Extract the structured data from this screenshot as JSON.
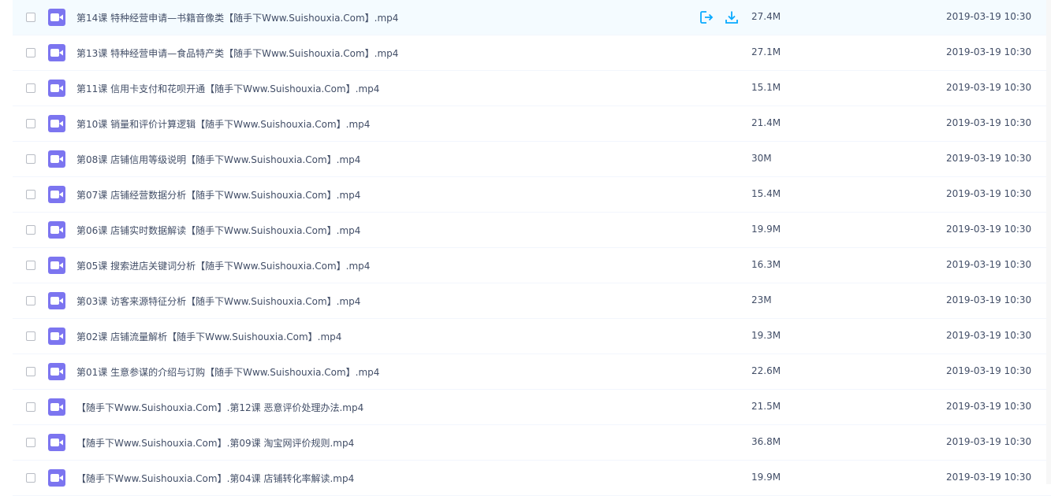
{
  "colors": {
    "accent": "#09aaff",
    "video_icon": "#7c75f0",
    "hover_row": "#f4fbff"
  },
  "row_actions": {
    "share_icon": "share-icon",
    "download_icon": "download-icon"
  },
  "files": [
    {
      "name": "第14课 特种经营申请—书籍音像类【随手下Www.Suishouxia.Com】.mp4",
      "size": "27.4M",
      "date": "2019-03-19 10:30",
      "hovered": true
    },
    {
      "name": "第13课 特种经营申请—食品特产类【随手下Www.Suishouxia.Com】.mp4",
      "size": "27.1M",
      "date": "2019-03-19 10:30"
    },
    {
      "name": "第11课 信用卡支付和花呗开通【随手下Www.Suishouxia.Com】.mp4",
      "size": "15.1M",
      "date": "2019-03-19 10:30"
    },
    {
      "name": "第10课 销量和评价计算逻辑【随手下Www.Suishouxia.Com】.mp4",
      "size": "21.4M",
      "date": "2019-03-19 10:30"
    },
    {
      "name": "第08课 店铺信用等级说明【随手下Www.Suishouxia.Com】.mp4",
      "size": "30M",
      "date": "2019-03-19 10:30"
    },
    {
      "name": "第07课 店铺经营数据分析【随手下Www.Suishouxia.Com】.mp4",
      "size": "15.4M",
      "date": "2019-03-19 10:30"
    },
    {
      "name": "第06课 店铺实时数据解读【随手下Www.Suishouxia.Com】.mp4",
      "size": "19.9M",
      "date": "2019-03-19 10:30"
    },
    {
      "name": "第05课 搜索进店关键词分析【随手下Www.Suishouxia.Com】.mp4",
      "size": "16.3M",
      "date": "2019-03-19 10:30"
    },
    {
      "name": "第03课 访客来源特征分析【随手下Www.Suishouxia.Com】.mp4",
      "size": "23M",
      "date": "2019-03-19 10:30"
    },
    {
      "name": "第02课 店铺流量解析【随手下Www.Suishouxia.Com】.mp4",
      "size": "19.3M",
      "date": "2019-03-19 10:30"
    },
    {
      "name": "第01课 生意参谋的介绍与订购【随手下Www.Suishouxia.Com】.mp4",
      "size": "22.6M",
      "date": "2019-03-19 10:30"
    },
    {
      "name": "【随手下Www.Suishouxia.Com】.第12课 恶意评价处理办法.mp4",
      "size": "21.5M",
      "date": "2019-03-19 10:30"
    },
    {
      "name": "【随手下Www.Suishouxia.Com】.第09课 淘宝网评价规则.mp4",
      "size": "36.8M",
      "date": "2019-03-19 10:30"
    },
    {
      "name": "【随手下Www.Suishouxia.Com】.第04课 店铺转化率解读.mp4",
      "size": "19.9M",
      "date": "2019-03-19 10:30"
    }
  ]
}
